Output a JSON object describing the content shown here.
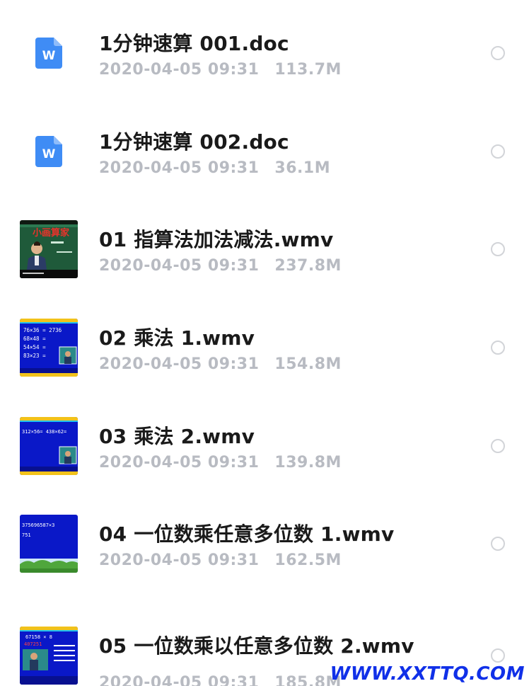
{
  "files": [
    {
      "name": "1分钟速算 001.doc",
      "date": "2020-04-05 09:31",
      "size": "113.7M",
      "icon": "word-doc-icon",
      "type": "doc"
    },
    {
      "name": "1分钟速算 002.doc",
      "date": "2020-04-05 09:31",
      "size": "36.1M",
      "icon": "word-doc-icon",
      "type": "doc"
    },
    {
      "name": "01 指算法加法减法.wmv",
      "date": "2020-04-05 09:31",
      "size": "237.8M",
      "icon": "video-thumbnail",
      "type": "video",
      "thumb_title": "小画算家"
    },
    {
      "name": "02 乘法 1.wmv",
      "date": "2020-04-05 09:31",
      "size": "154.8M",
      "icon": "video-thumbnail",
      "type": "video",
      "thumb_lines": [
        "76×36 = 2736",
        "68×48 =",
        "54×54 =",
        "83×23 ="
      ]
    },
    {
      "name": "03 乘法 2.wmv",
      "date": "2020-04-05 09:31",
      "size": "139.8M",
      "icon": "video-thumbnail",
      "type": "video",
      "thumb_lines": [
        "312×56=  438×62="
      ]
    },
    {
      "name": "04 一位数乘任意多位数 1.wmv",
      "date": "2020-04-05 09:31",
      "size": "162.5M",
      "icon": "video-thumbnail",
      "type": "video",
      "thumb_lines": [
        "375696587×3",
        "751"
      ]
    },
    {
      "name": "05 一位数乘以任意多位数 2.wmv",
      "date": "2020-04-05 09:31",
      "size": "185.8M",
      "icon": "video-thumbnail",
      "type": "video",
      "thumb_lines": [
        "67158 × 8",
        "407251"
      ]
    }
  ],
  "watermark": "WWW.XXTTQ.COM",
  "colors": {
    "doc_blue": "#3f8cf5",
    "meta_gray": "#b8bbc2",
    "name_black": "#1a1a1a",
    "video_blue": "#0a18c8",
    "watermark_blue": "#1030e8"
  }
}
